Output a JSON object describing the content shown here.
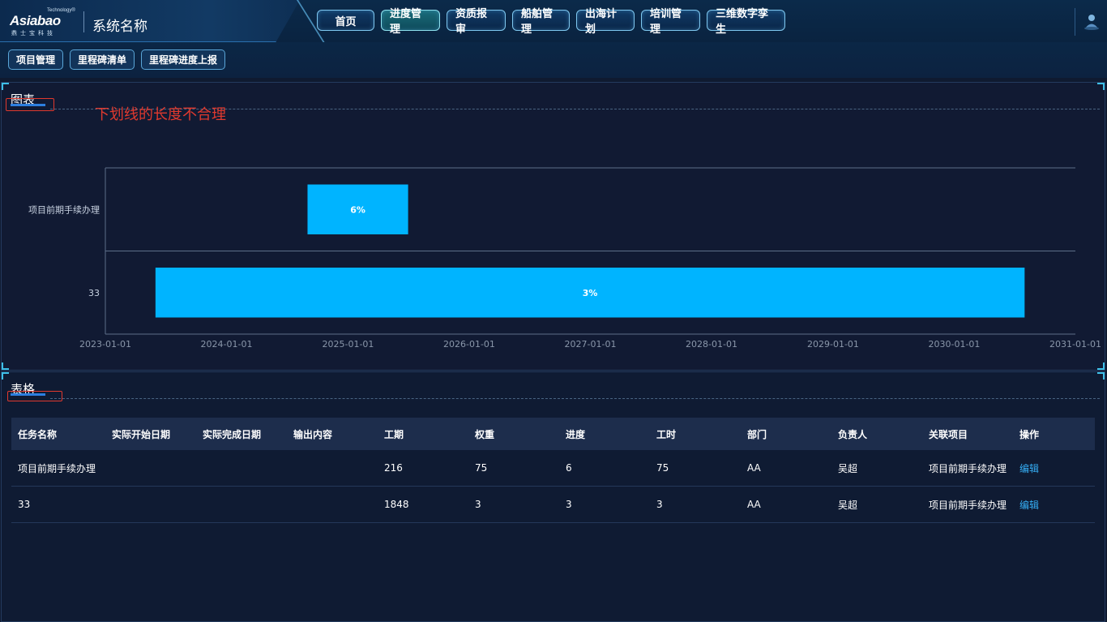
{
  "brand": {
    "logo_main": "Asiabao",
    "logo_sup": "Technology®",
    "logo_sub": "鼎士宝科技",
    "system_name": "系统名称"
  },
  "nav": {
    "items": [
      {
        "label": "首页",
        "active": false
      },
      {
        "label": "进度管理",
        "active": true
      },
      {
        "label": "资质报审",
        "active": false
      },
      {
        "label": "船舶管理",
        "active": false
      },
      {
        "label": "出海计划",
        "active": false
      },
      {
        "label": "培训管理",
        "active": false
      },
      {
        "label": "三维数字孪生",
        "active": false
      }
    ]
  },
  "subnav": {
    "items": [
      "项目管理",
      "里程碑清单",
      "里程碑进度上报"
    ]
  },
  "chart_section": {
    "title": "图表",
    "annotation": "下划线的长度不合理"
  },
  "chart_data": {
    "type": "bar",
    "orientation": "horizontal-gantt",
    "categories": [
      "项目前期手续办理",
      "33"
    ],
    "x_ticks": [
      "2023-01-01",
      "2024-01-01",
      "2025-01-01",
      "2026-01-01",
      "2027-01-01",
      "2028-01-01",
      "2029-01-01",
      "2030-01-01",
      "2031-01-01"
    ],
    "xlim": [
      "2023-01-01",
      "2031-01-01"
    ],
    "series": [
      {
        "bars": [
          {
            "category": "项目前期手续办理",
            "start": "2024-09-01",
            "end": "2025-07-01",
            "label": "6%"
          },
          {
            "category": "33",
            "start": "2023-06-01",
            "end": "2030-08-01",
            "label": "3%"
          }
        ]
      }
    ],
    "bar_color": "#00b4ff",
    "grid": true
  },
  "table_section": {
    "title": "表格",
    "headers": [
      "任务名称",
      "实际开始日期",
      "实际完成日期",
      "输出内容",
      "工期",
      "权重",
      "进度",
      "工时",
      "部门",
      "负责人",
      "关联项目",
      "操作"
    ],
    "rows": [
      [
        "项目前期手续办理",
        "",
        "",
        "",
        "216",
        "75",
        "6",
        "75",
        "AA",
        "吴超",
        "项目前期手续办理",
        "编辑"
      ],
      [
        "33",
        "",
        "",
        "",
        "1848",
        "3",
        "3",
        "3",
        "AA",
        "吴超",
        "项目前期手续办理",
        "编辑"
      ]
    ]
  },
  "colors": {
    "accent": "#00b4ff",
    "annotation_red": "#e0392e",
    "link": "#35aef5"
  }
}
